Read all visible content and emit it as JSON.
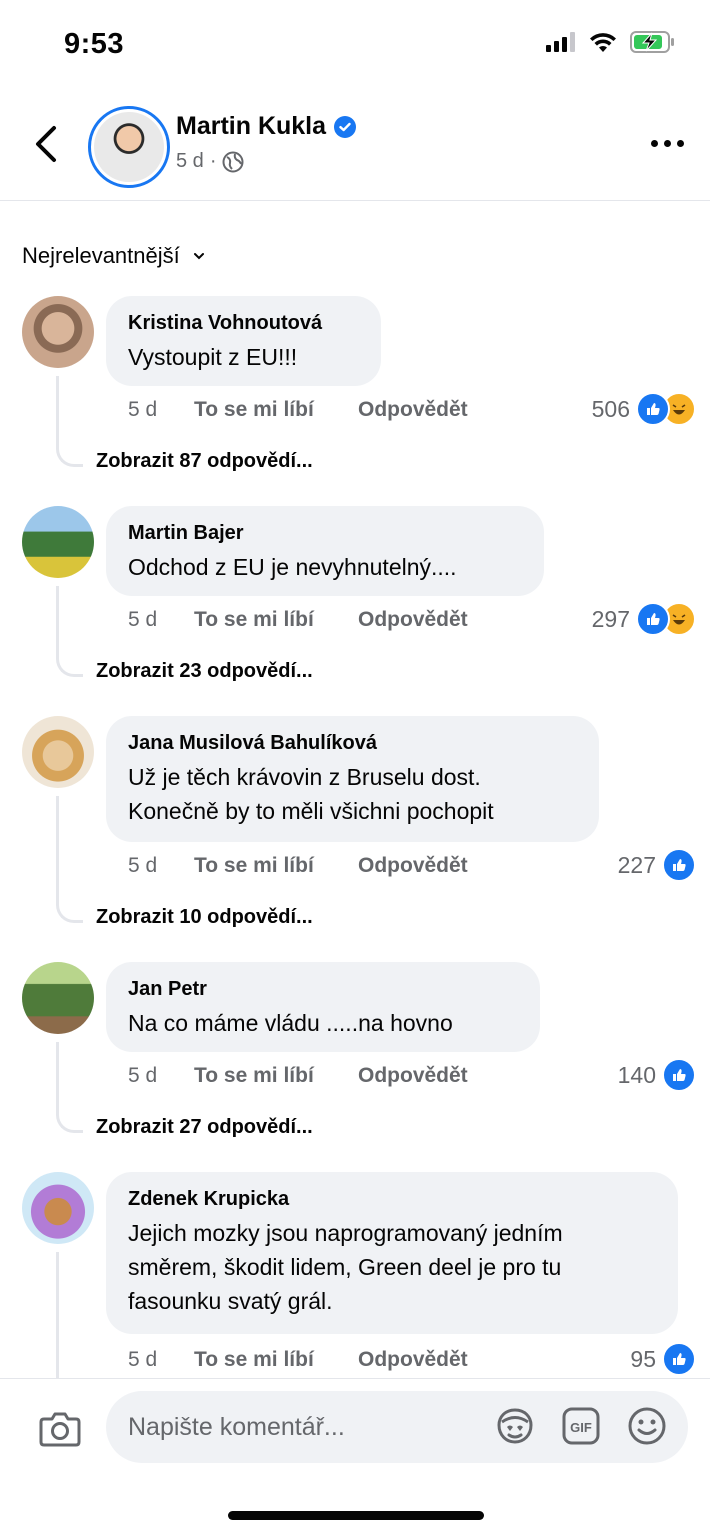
{
  "status_bar": {
    "time": "9:53"
  },
  "header": {
    "name": "Martin Kukla",
    "age": "5 d",
    "separator": "·"
  },
  "sort": {
    "label": "Nejrelevantnější"
  },
  "comments": [
    {
      "author": "Kristina Vohnoutová",
      "text": "Vystoupit z EU!!!",
      "age": "5 d",
      "like_label": "To se mi líbí",
      "reply_label": "Odpovědět",
      "reaction_count": "506",
      "reactions": [
        "like-icon",
        "haha-icon"
      ],
      "view_replies": "Zobrazit 87 odpovědí..."
    },
    {
      "author": "Martin Bajer",
      "text": "Odchod z EU je nevyhnutelný....",
      "age": "5 d",
      "like_label": "To se mi líbí",
      "reply_label": "Odpovědět",
      "reaction_count": "297",
      "reactions": [
        "like-icon",
        "haha-icon"
      ],
      "view_replies": "Zobrazit 23 odpovědí..."
    },
    {
      "author": "Jana Musilová Bahulíková",
      "text": "Už je těch krávovin z Bruselu dost.\nKonečně by to měli všichni pochopit",
      "age": "5 d",
      "like_label": "To se mi líbí",
      "reply_label": "Odpovědět",
      "reaction_count": "227",
      "reactions": [
        "like-icon"
      ],
      "view_replies": "Zobrazit 10 odpovědí..."
    },
    {
      "author": "Jan Petr",
      "text": "Na co máme vládu .....na hovno",
      "age": "5 d",
      "like_label": "To se mi líbí",
      "reply_label": "Odpovědět",
      "reaction_count": "140",
      "reactions": [
        "like-icon"
      ],
      "view_replies": "Zobrazit 27 odpovědí..."
    },
    {
      "author": "Zdenek Krupicka",
      "text": "Jejich mozky jsou naprogramovaný jedním\nsměrem, škodit lidem, Green deel je pro tu\nfasounku svatý grál.",
      "age": "5 d",
      "like_label": "To se mi líbí",
      "reply_label": "Odpovědět",
      "reaction_count": "95",
      "reactions": [
        "like-icon"
      ]
    }
  ],
  "composer": {
    "placeholder": "Napište komentář..."
  },
  "colors": {
    "accent": "#1877f2",
    "bubble": "#f0f2f5",
    "muted": "#65676b"
  }
}
